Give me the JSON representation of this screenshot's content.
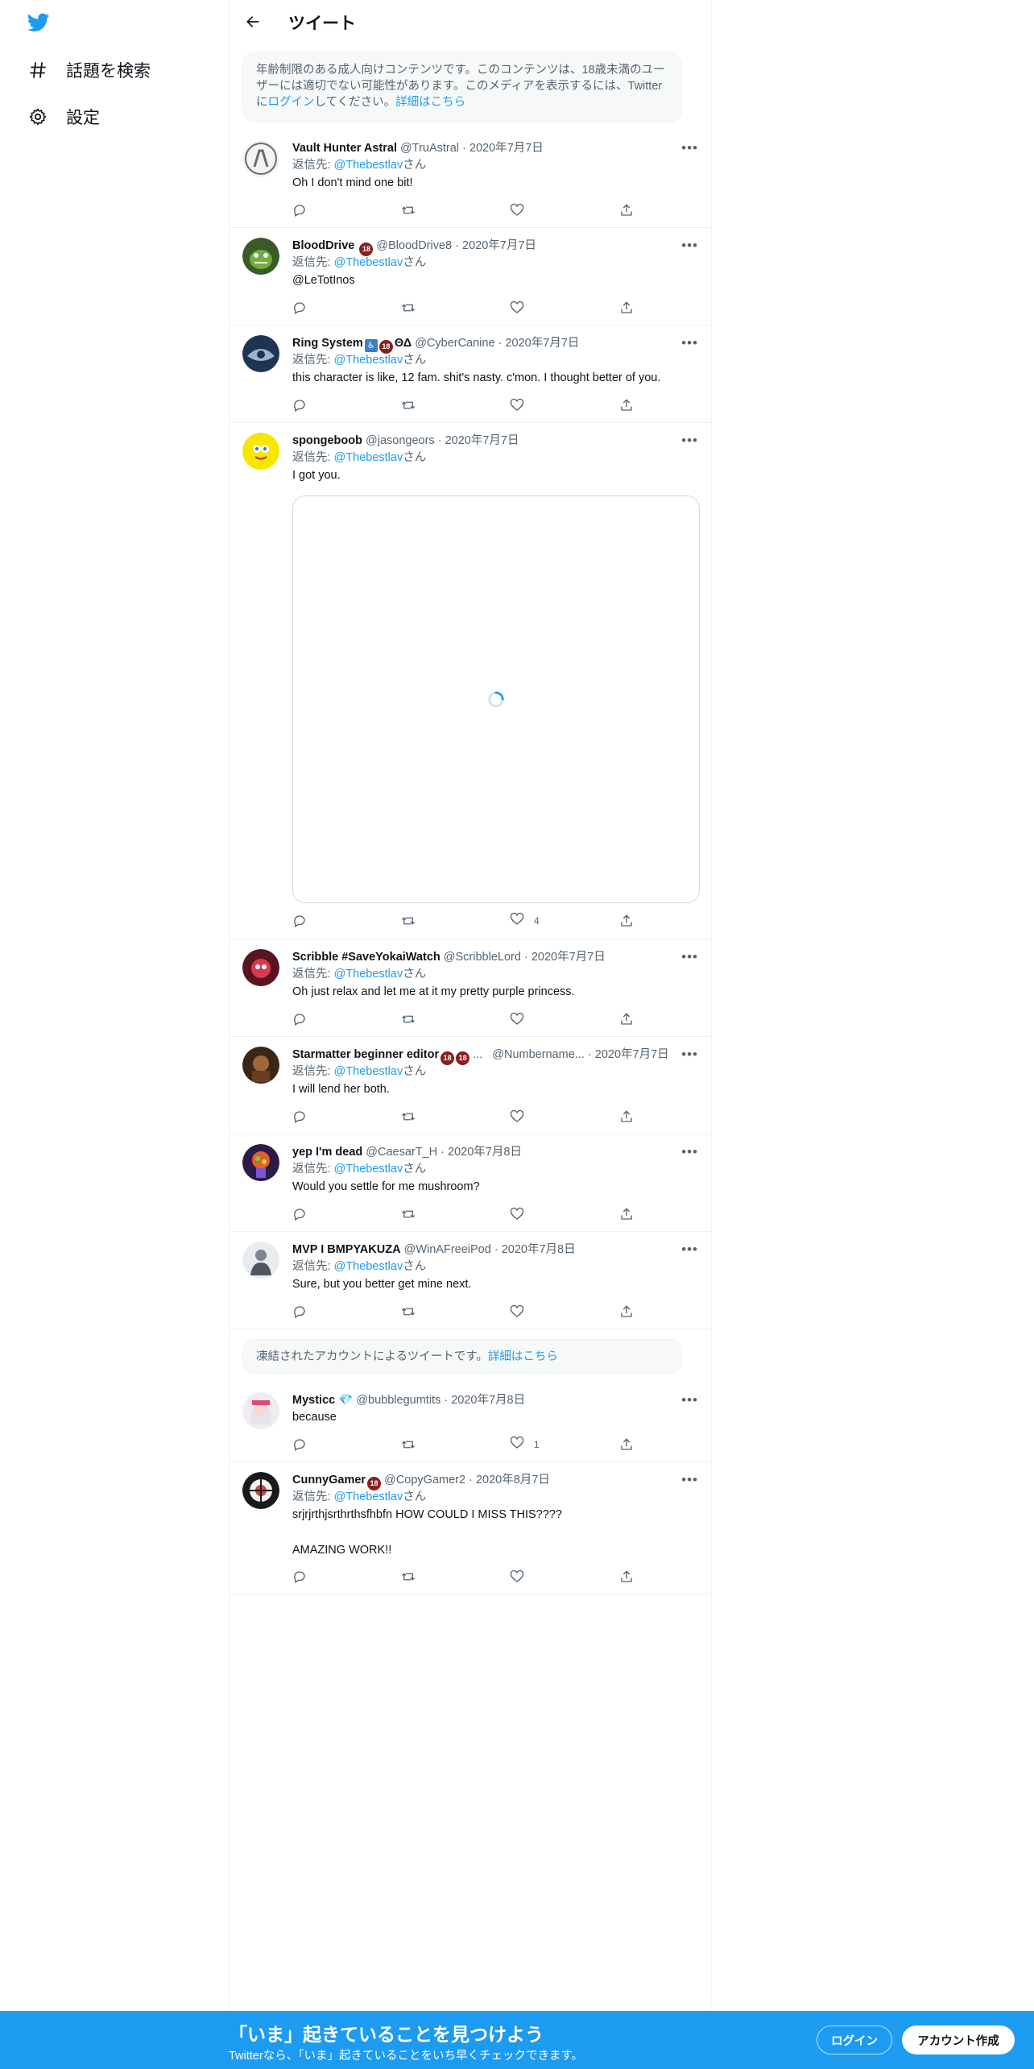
{
  "nav": {
    "explore_label": "話題を検索",
    "settings_label": "設定"
  },
  "header": {
    "title": "ツイート"
  },
  "notices": {
    "age_restricted": {
      "text": "年齢制限のある成人向けコンテンツです。このコンテンツは、18歳未満のユーザーには適切でない可能性があります。このメディアを表示するには、Twitterに",
      "login_link": "ログイン",
      "text2": "してください。",
      "details_link": "詳細はこちら"
    },
    "suspended": {
      "text": "凍結されたアカウントによるツイートです。",
      "details_link": "詳細はこちら"
    }
  },
  "reply_prefix": "返信先: ",
  "reply_suffix": "さん",
  "tweets": [
    {
      "name": "Vault Hunter Astral",
      "badges": "",
      "handle": "@TruAstral",
      "date": "2020年7月7日",
      "reply_to": "@Thebestlav",
      "text": "Oh I don't mind one bit!",
      "likes": ""
    },
    {
      "name": "BloodDrive",
      "badges": "18",
      "handle": "@BloodDrive8",
      "date": "2020年7月7日",
      "reply_to": "@Thebestlav",
      "text": "@LeTotInos",
      "likes": ""
    },
    {
      "name": "Ring System",
      "badges": "♿ 18 ΘΔ",
      "handle": "@CyberCanine",
      "date": "2020年7月7日",
      "reply_to": "@Thebestlav",
      "text": "this character is like, 12 fam. shit's nasty. c'mon. I thought better of you.",
      "likes": ""
    },
    {
      "name": "spongeboob",
      "badges": "",
      "handle": "@jasongeors",
      "date": "2020年7月7日",
      "reply_to": "@Thebestlav",
      "text": "I got you.",
      "likes": "4"
    },
    {
      "name": "Scribble #SaveYokaiWatch",
      "badges": "",
      "handle": "@ScribbleLord",
      "date": "2020年7月7日",
      "reply_to": "@Thebestlav",
      "text": "Oh just relax and let me at it my pretty purple princess.",
      "likes": ""
    },
    {
      "name": "Starmatter beginner editor",
      "badges": "18 18 ...",
      "handle": "@Numbername...",
      "date": "2020年7月7日",
      "reply_to": "@Thebestlav",
      "text": "I will lend her both.",
      "likes": ""
    },
    {
      "name": "yep I'm dead",
      "badges": "",
      "handle": "@CaesarT_H",
      "date": "2020年7月8日",
      "reply_to": "@Thebestlav",
      "text": "Would you settle for me mushroom?",
      "likes": ""
    },
    {
      "name": "MVP I BMPYAKUZA",
      "badges": "",
      "handle": "@WinAFreeiPod",
      "date": "2020年7月8日",
      "reply_to": "@Thebestlav",
      "text": "Sure, but you better get mine next.",
      "likes": ""
    },
    {
      "name": "Mysticc",
      "badges": "💎",
      "handle": "@bubblegumtits",
      "date": "2020年7月8日",
      "reply_to": "",
      "text": "because",
      "likes": "1"
    },
    {
      "name": "CunnyGamer",
      "badges": "18",
      "handle": "@CopyGamer2",
      "date": "2020年8月7日",
      "reply_to": "@Thebestlav",
      "text": "srjrjrthjsrthrthsfhbfn HOW COULD I MISS THIS????\n\nAMAZING WORK!!",
      "likes": ""
    }
  ],
  "banner": {
    "title": "「いま」起きていることを見つけよう",
    "subtitle": "Twitterなら、「いま」起きていることをいち早くチェックできます。",
    "login_label": "ログイン",
    "signup_label": "アカウント作成"
  },
  "colors": {
    "accent": "#1d9bf0",
    "text": "#0f1419",
    "muted": "#536471",
    "border": "#eff3f4"
  }
}
